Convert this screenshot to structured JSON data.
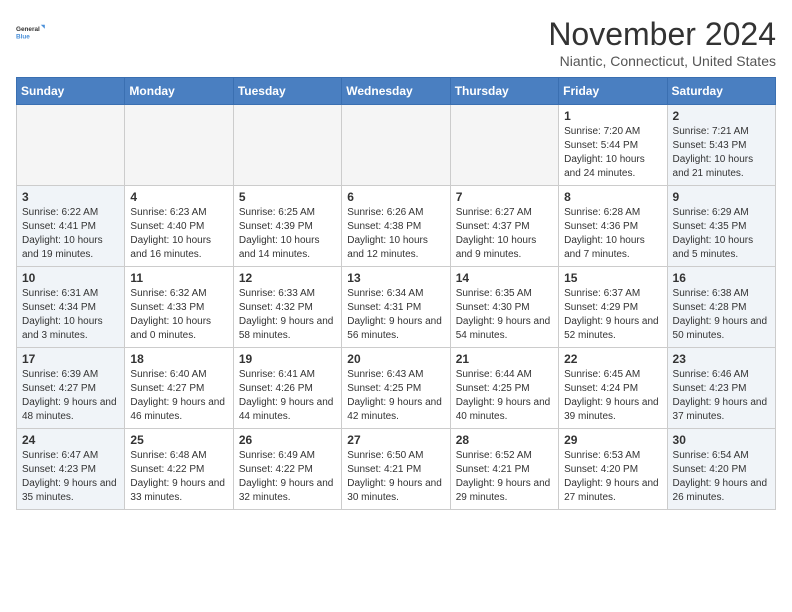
{
  "logo": {
    "line1": "General",
    "line2": "Blue"
  },
  "title": "November 2024",
  "subtitle": "Niantic, Connecticut, United States",
  "days_of_week": [
    "Sunday",
    "Monday",
    "Tuesday",
    "Wednesday",
    "Thursday",
    "Friday",
    "Saturday"
  ],
  "weeks": [
    [
      {
        "day": "",
        "info": ""
      },
      {
        "day": "",
        "info": ""
      },
      {
        "day": "",
        "info": ""
      },
      {
        "day": "",
        "info": ""
      },
      {
        "day": "",
        "info": ""
      },
      {
        "day": "1",
        "info": "Sunrise: 7:20 AM\nSunset: 5:44 PM\nDaylight: 10 hours and 24 minutes."
      },
      {
        "day": "2",
        "info": "Sunrise: 7:21 AM\nSunset: 5:43 PM\nDaylight: 10 hours and 21 minutes."
      }
    ],
    [
      {
        "day": "3",
        "info": "Sunrise: 6:22 AM\nSunset: 4:41 PM\nDaylight: 10 hours and 19 minutes."
      },
      {
        "day": "4",
        "info": "Sunrise: 6:23 AM\nSunset: 4:40 PM\nDaylight: 10 hours and 16 minutes."
      },
      {
        "day": "5",
        "info": "Sunrise: 6:25 AM\nSunset: 4:39 PM\nDaylight: 10 hours and 14 minutes."
      },
      {
        "day": "6",
        "info": "Sunrise: 6:26 AM\nSunset: 4:38 PM\nDaylight: 10 hours and 12 minutes."
      },
      {
        "day": "7",
        "info": "Sunrise: 6:27 AM\nSunset: 4:37 PM\nDaylight: 10 hours and 9 minutes."
      },
      {
        "day": "8",
        "info": "Sunrise: 6:28 AM\nSunset: 4:36 PM\nDaylight: 10 hours and 7 minutes."
      },
      {
        "day": "9",
        "info": "Sunrise: 6:29 AM\nSunset: 4:35 PM\nDaylight: 10 hours and 5 minutes."
      }
    ],
    [
      {
        "day": "10",
        "info": "Sunrise: 6:31 AM\nSunset: 4:34 PM\nDaylight: 10 hours and 3 minutes."
      },
      {
        "day": "11",
        "info": "Sunrise: 6:32 AM\nSunset: 4:33 PM\nDaylight: 10 hours and 0 minutes."
      },
      {
        "day": "12",
        "info": "Sunrise: 6:33 AM\nSunset: 4:32 PM\nDaylight: 9 hours and 58 minutes."
      },
      {
        "day": "13",
        "info": "Sunrise: 6:34 AM\nSunset: 4:31 PM\nDaylight: 9 hours and 56 minutes."
      },
      {
        "day": "14",
        "info": "Sunrise: 6:35 AM\nSunset: 4:30 PM\nDaylight: 9 hours and 54 minutes."
      },
      {
        "day": "15",
        "info": "Sunrise: 6:37 AM\nSunset: 4:29 PM\nDaylight: 9 hours and 52 minutes."
      },
      {
        "day": "16",
        "info": "Sunrise: 6:38 AM\nSunset: 4:28 PM\nDaylight: 9 hours and 50 minutes."
      }
    ],
    [
      {
        "day": "17",
        "info": "Sunrise: 6:39 AM\nSunset: 4:27 PM\nDaylight: 9 hours and 48 minutes."
      },
      {
        "day": "18",
        "info": "Sunrise: 6:40 AM\nSunset: 4:27 PM\nDaylight: 9 hours and 46 minutes."
      },
      {
        "day": "19",
        "info": "Sunrise: 6:41 AM\nSunset: 4:26 PM\nDaylight: 9 hours and 44 minutes."
      },
      {
        "day": "20",
        "info": "Sunrise: 6:43 AM\nSunset: 4:25 PM\nDaylight: 9 hours and 42 minutes."
      },
      {
        "day": "21",
        "info": "Sunrise: 6:44 AM\nSunset: 4:25 PM\nDaylight: 9 hours and 40 minutes."
      },
      {
        "day": "22",
        "info": "Sunrise: 6:45 AM\nSunset: 4:24 PM\nDaylight: 9 hours and 39 minutes."
      },
      {
        "day": "23",
        "info": "Sunrise: 6:46 AM\nSunset: 4:23 PM\nDaylight: 9 hours and 37 minutes."
      }
    ],
    [
      {
        "day": "24",
        "info": "Sunrise: 6:47 AM\nSunset: 4:23 PM\nDaylight: 9 hours and 35 minutes."
      },
      {
        "day": "25",
        "info": "Sunrise: 6:48 AM\nSunset: 4:22 PM\nDaylight: 9 hours and 33 minutes."
      },
      {
        "day": "26",
        "info": "Sunrise: 6:49 AM\nSunset: 4:22 PM\nDaylight: 9 hours and 32 minutes."
      },
      {
        "day": "27",
        "info": "Sunrise: 6:50 AM\nSunset: 4:21 PM\nDaylight: 9 hours and 30 minutes."
      },
      {
        "day": "28",
        "info": "Sunrise: 6:52 AM\nSunset: 4:21 PM\nDaylight: 9 hours and 29 minutes."
      },
      {
        "day": "29",
        "info": "Sunrise: 6:53 AM\nSunset: 4:20 PM\nDaylight: 9 hours and 27 minutes."
      },
      {
        "day": "30",
        "info": "Sunrise: 6:54 AM\nSunset: 4:20 PM\nDaylight: 9 hours and 26 minutes."
      }
    ]
  ]
}
